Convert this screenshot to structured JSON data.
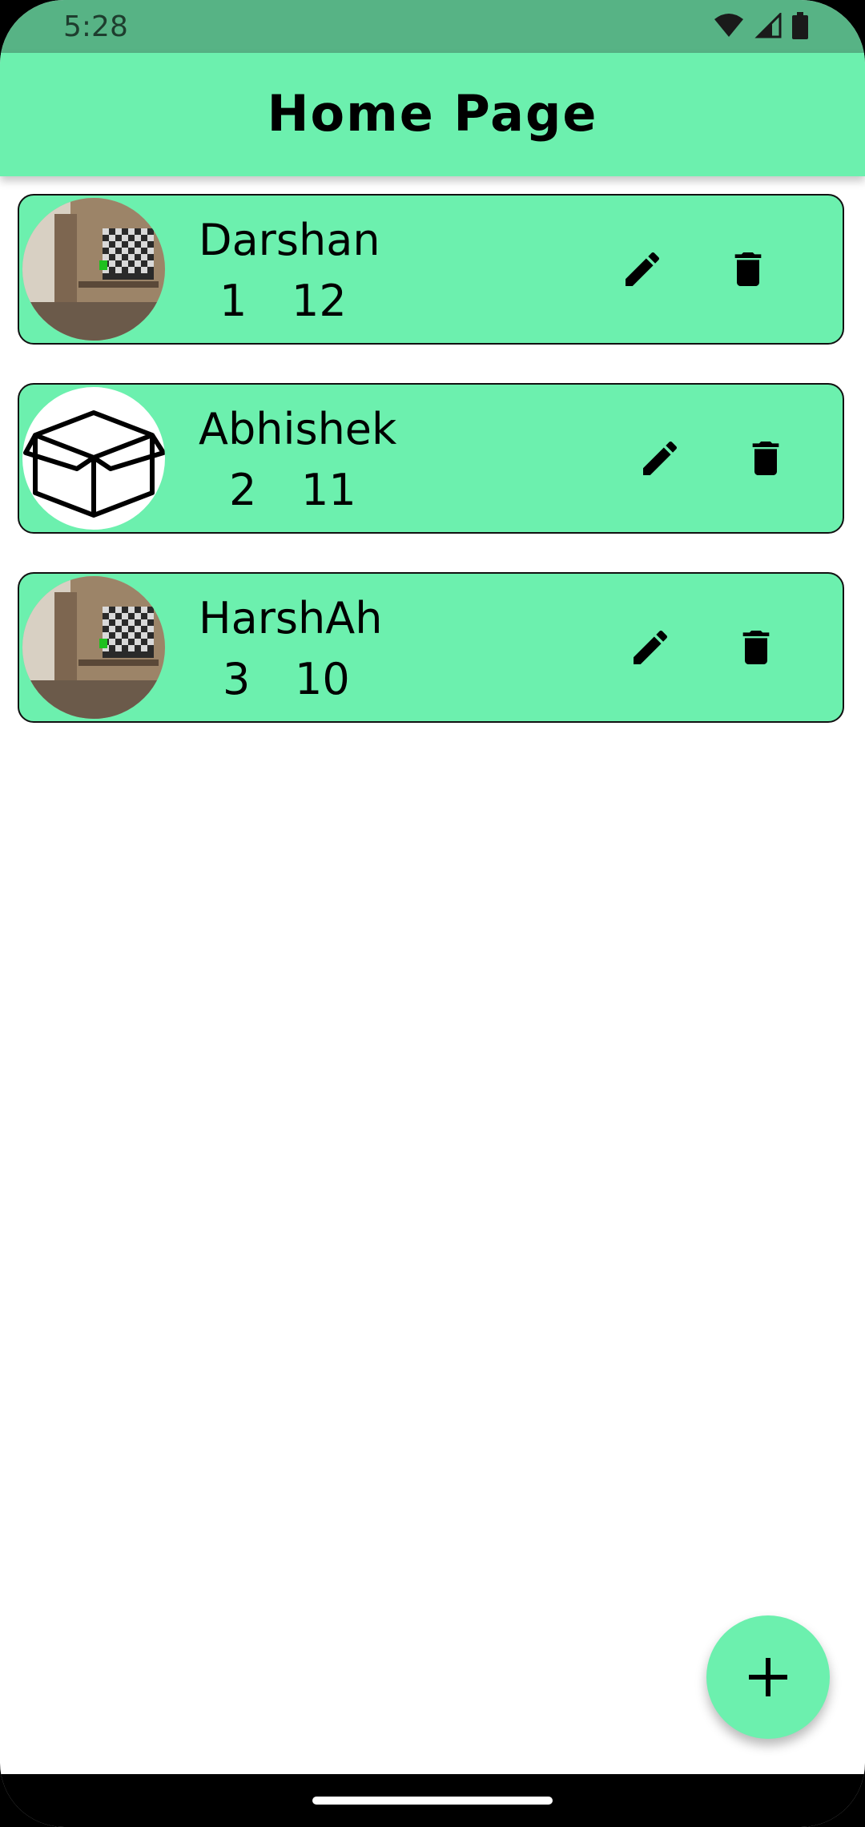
{
  "status_bar": {
    "time": "5:28",
    "icons": [
      "wifi-icon",
      "signal-icon",
      "battery-icon"
    ]
  },
  "app_bar": {
    "title": "Home Page"
  },
  "list": {
    "items": [
      {
        "name": "Darshan",
        "num1": "1",
        "num2": "12",
        "avatar": "room-photo"
      },
      {
        "name": "Abhishek",
        "num1": "2",
        "num2": "11",
        "avatar": "box-icon"
      },
      {
        "name": "HarshAh",
        "num1": "3",
        "num2": "10",
        "avatar": "room-photo"
      }
    ]
  },
  "fab": {
    "icon": "plus-icon"
  },
  "colors": {
    "accent": "#6cf0ae",
    "status_bar": "#57b385",
    "text": "#000000"
  }
}
